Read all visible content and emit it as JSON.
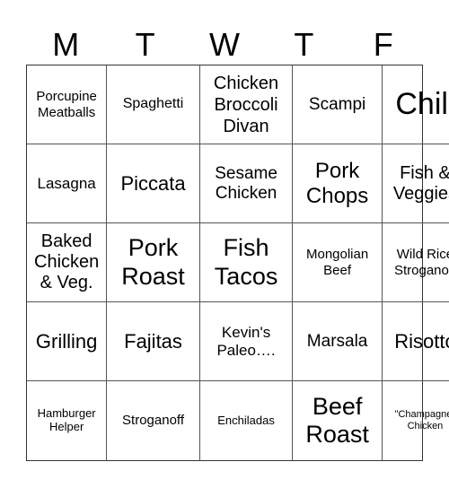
{
  "header": [
    "M",
    "T",
    "W",
    "T",
    "F"
  ],
  "cells": [
    "Porcupine Meatballs",
    "Spaghetti",
    "Chicken Broccoli Divan",
    "Scampi",
    "Chili",
    "Lasagna",
    "Piccata",
    "Sesame Chicken",
    "Pork Chops",
    "Fish & Veggies",
    "Baked Chicken & Veg.",
    "Pork Roast",
    "Fish Tacos",
    "Mongolian Beef",
    "Wild Rice Stroganoff",
    "Grilling",
    "Fajitas",
    "Kevin's Paleo….",
    "Marsala",
    "Risotto",
    "Hamburger Helper",
    "Stroganoff",
    "Enchiladas",
    "Beef Roast",
    "\"Champagne\" Chicken"
  ]
}
